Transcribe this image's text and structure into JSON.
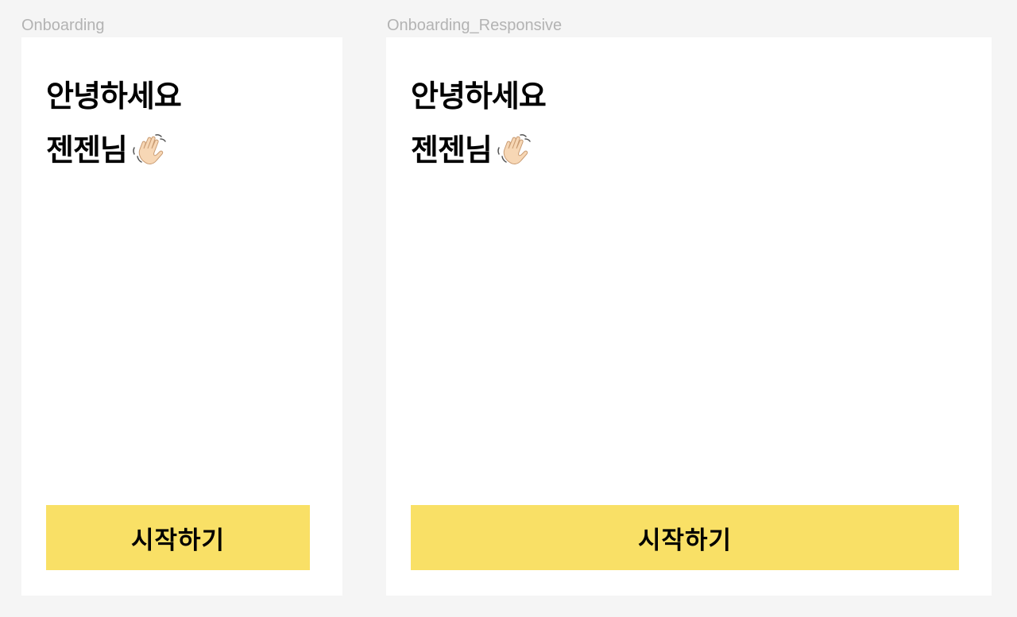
{
  "frames": [
    {
      "label": "Onboarding",
      "greeting": "안녕하세요",
      "user_name": "젠젠님",
      "wave_icon": "waving-hand-icon",
      "start_button": "시작하기"
    },
    {
      "label": "Onboarding_Responsive",
      "greeting": "안녕하세요",
      "user_name": "젠젠님",
      "wave_icon": "waving-hand-icon",
      "start_button": "시작하기"
    }
  ],
  "colors": {
    "canvas": "#f5f5f5",
    "frame": "#ffffff",
    "frame_label": "#b3b3b3",
    "button": "#f9e066",
    "text": "#000000",
    "skin": "#f7d7b5"
  }
}
